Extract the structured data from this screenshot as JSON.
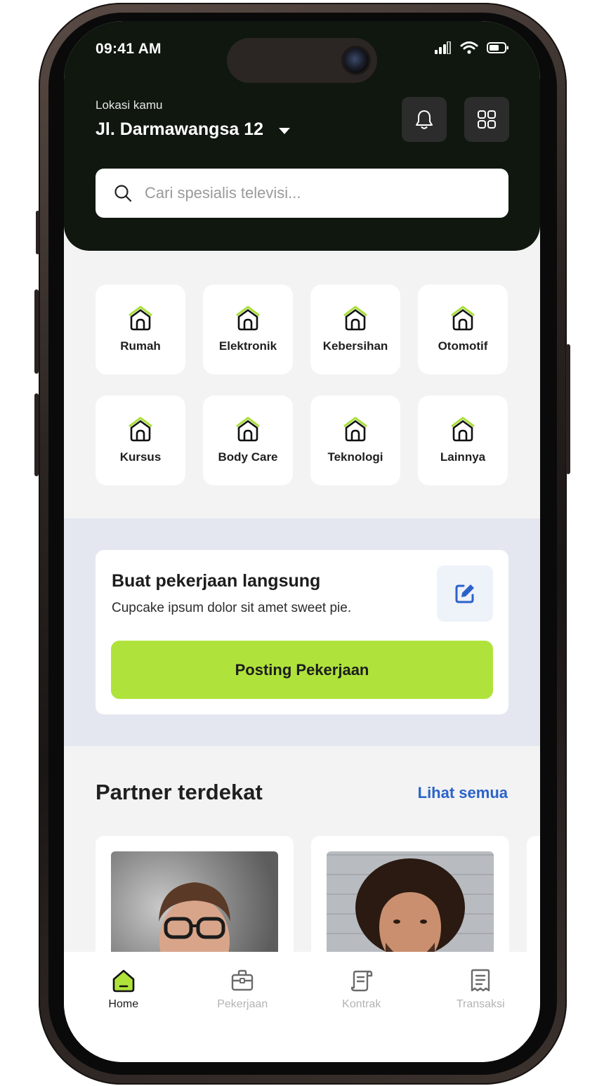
{
  "status": {
    "time": "09:41 AM"
  },
  "location": {
    "label": "Lokasi kamu",
    "value": "Jl. Darmawangsa 12"
  },
  "search": {
    "placeholder": "Cari spesialis televisi..."
  },
  "categories": [
    {
      "label": "Rumah",
      "icon": "house-icon"
    },
    {
      "label": "Elektronik",
      "icon": "house-icon"
    },
    {
      "label": "Kebersihan",
      "icon": "house-icon"
    },
    {
      "label": "Otomotif",
      "icon": "house-icon"
    },
    {
      "label": "Kursus",
      "icon": "house-icon"
    },
    {
      "label": "Body Care",
      "icon": "house-icon"
    },
    {
      "label": "Teknologi",
      "icon": "house-icon"
    },
    {
      "label": "Lainnya",
      "icon": "house-icon"
    }
  ],
  "job": {
    "title": "Buat pekerjaan langsung",
    "subtitle": "Cupcake ipsum dolor sit amet sweet pie.",
    "button": "Posting Pekerjaan"
  },
  "partners": {
    "title": "Partner terdekat",
    "see_all": "Lihat semua"
  },
  "nav": [
    {
      "label": "Home",
      "icon": "home-icon",
      "active": true
    },
    {
      "label": "Pekerjaan",
      "icon": "briefcase-icon",
      "active": false
    },
    {
      "label": "Kontrak",
      "icon": "contract-icon",
      "active": false
    },
    {
      "label": "Transaksi",
      "icon": "receipt-icon",
      "active": false
    }
  ],
  "colors": {
    "header_bg": "#0f170f",
    "accent_green": "#afe33c",
    "link_blue": "#2a62c9"
  }
}
